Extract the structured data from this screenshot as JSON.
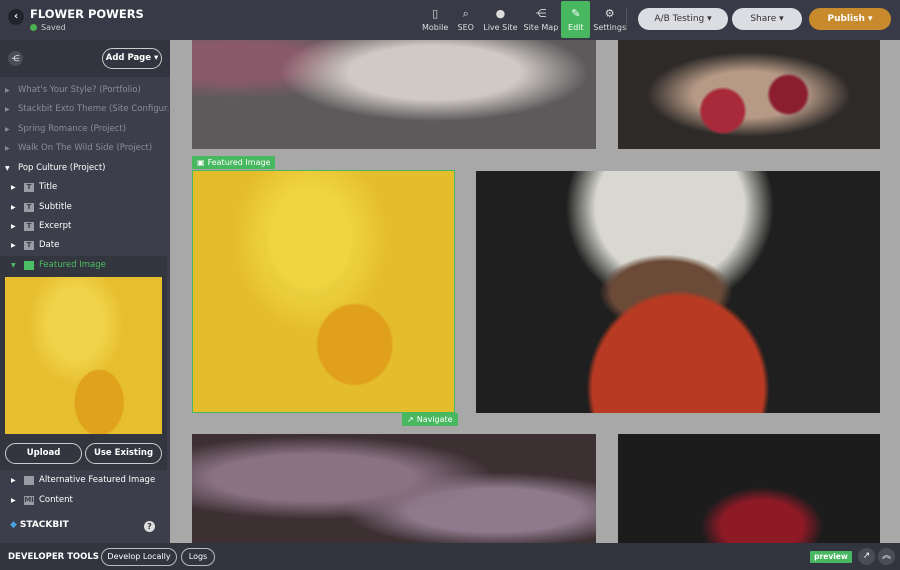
{
  "header": {
    "title": "FLOWER POWERS",
    "status": "Saved",
    "tools": [
      {
        "label": "Mobile",
        "icon": "▯"
      },
      {
        "label": "SEO",
        "icon": "⌕"
      },
      {
        "label": "Live Site",
        "icon": "●"
      },
      {
        "label": "Site Map",
        "icon": "⋲"
      },
      {
        "label": "Edit",
        "icon": "✎"
      },
      {
        "label": "Settings",
        "icon": "⚙"
      }
    ],
    "ab_testing": "A/B Testing ▾",
    "share": "Share ▾",
    "publish": "Publish ▾"
  },
  "sidebar": {
    "add_page": "Add Page ▾",
    "pages": [
      "What's Your Style? (Portfolio)",
      "Stackbit Exto Theme (Site Configur...",
      "Spring Romance (Project)",
      "Walk On The Wild Side (Project)",
      "Pop Culture (Project)"
    ],
    "fields": [
      "Title",
      "Subtitle",
      "Excerpt",
      "Date"
    ],
    "featured": "Featured Image",
    "upload": "Upload",
    "use_existing": "Use Existing",
    "more_fields": [
      "Alternative Featured Image",
      "Content"
    ],
    "field_icons": [
      "T",
      "MI"
    ],
    "logo": "STACKBIT",
    "help": "?"
  },
  "canvas": {
    "featured_label": "Featured Image",
    "navigate_label": "Navigate"
  },
  "footer": {
    "title": "DEVELOPER TOOLS",
    "develop_locally": "Develop Locally",
    "logs": "Logs",
    "preview": "preview"
  },
  "colors": {
    "accent": "#48b860",
    "publish": "#c78a2c"
  }
}
